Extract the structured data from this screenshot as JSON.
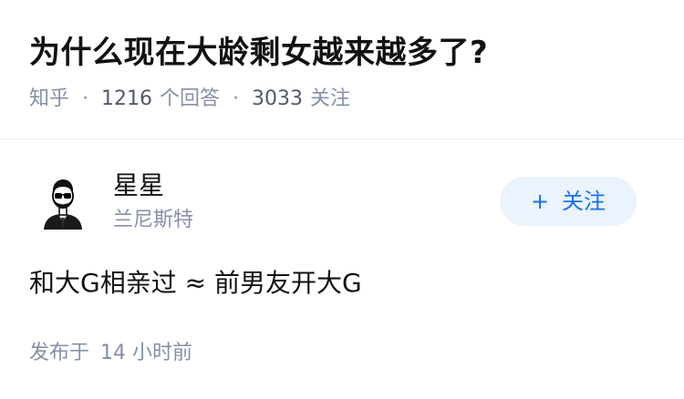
{
  "question": {
    "title": "为什么现在大龄剩女越来越多了?",
    "source": "知乎",
    "answers_count": "1216",
    "answers_label": "个回答",
    "followers_count": "3033",
    "followers_label": "关注",
    "separator": "·"
  },
  "author": {
    "name": "星星",
    "bio": "兰尼斯特",
    "avatar_icon": "sunglasses-man-icon",
    "follow_icon": "plus-icon",
    "follow_plus": "+",
    "follow_label": "关注"
  },
  "answer": {
    "text": "和大G相亲过 ≈ 前男友开大G",
    "posted_label": "发布于",
    "posted_time": "14 小时前"
  },
  "colors": {
    "title": "#121212",
    "meta": "#8590a6",
    "accent": "#1772f6",
    "follow_bg": "#ebf3fc"
  }
}
